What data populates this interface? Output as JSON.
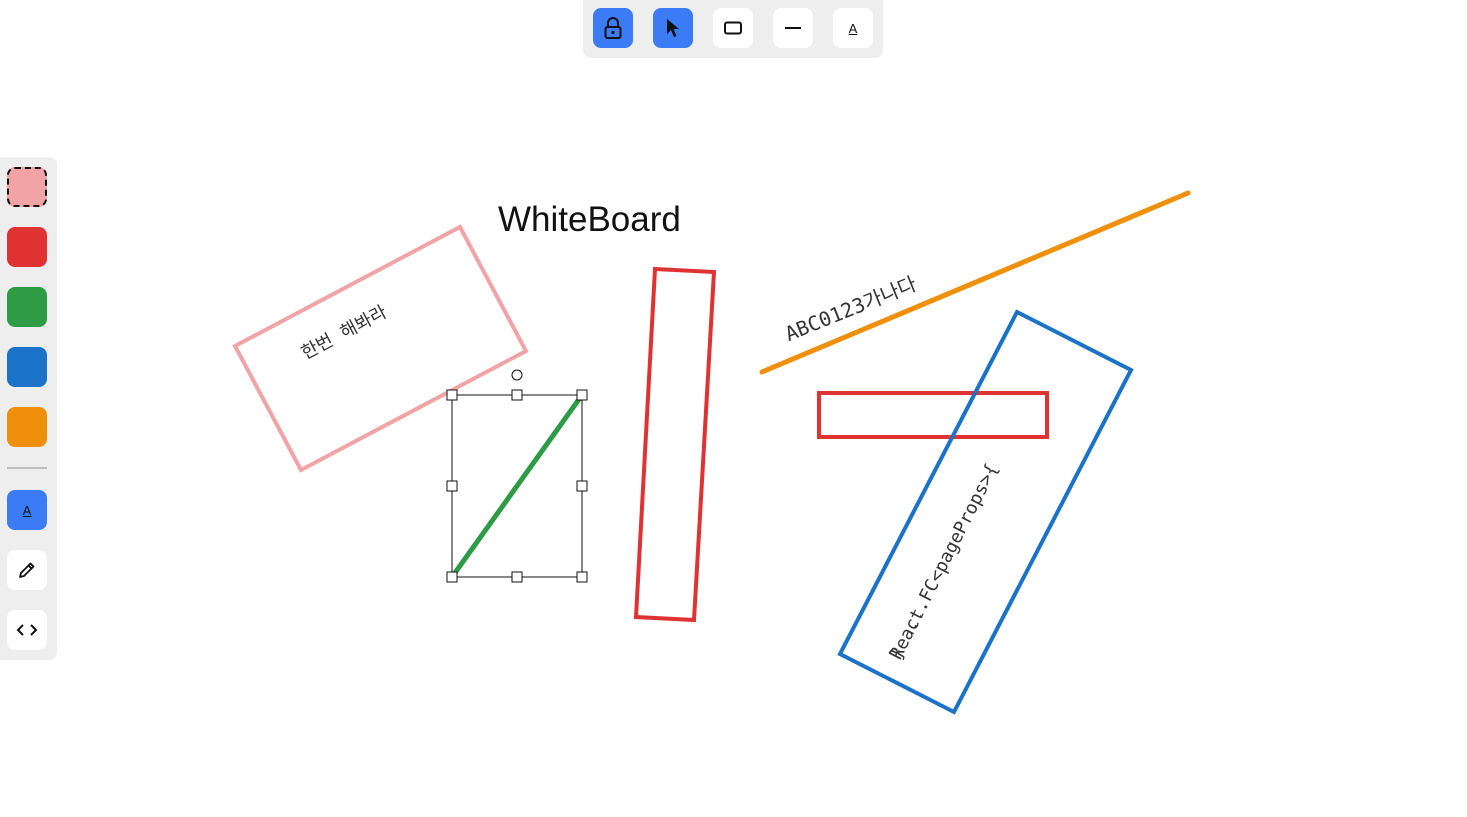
{
  "toolbar": {
    "tools": [
      {
        "name": "lock",
        "icon": "lock-icon",
        "active": true
      },
      {
        "name": "select",
        "icon": "cursor-icon",
        "active": true
      },
      {
        "name": "rectangle",
        "icon": "rectangle-icon",
        "active": false
      },
      {
        "name": "line",
        "icon": "line-icon",
        "active": false
      },
      {
        "name": "text",
        "icon": "text-icon",
        "label": "A",
        "active": false
      }
    ]
  },
  "palette": {
    "colors": [
      {
        "hex": "#f2a3a6",
        "selected": true
      },
      {
        "hex": "#e03232",
        "selected": false
      },
      {
        "hex": "#2e9c45",
        "selected": false
      },
      {
        "hex": "#1a73c8",
        "selected": false
      },
      {
        "hex": "#f0900a",
        "selected": false
      }
    ],
    "text_style_label": "A",
    "pencil_icon": "pencil-icon",
    "code_icon": "code-icon"
  },
  "canvas": {
    "title": "WhiteBoard",
    "pink_note": "한번 해봐라",
    "orange_note": "ABC0123가나다",
    "code_lines": [
      "React.FC<pageProps>{",
      "   ...",
      "}"
    ],
    "colors": {
      "pink": "#f2a3a6",
      "red": "#e03232",
      "green": "#2e9c45",
      "blue": "#1a73c8",
      "orange": "#f0900a",
      "accent": "#3b7bf5"
    }
  }
}
